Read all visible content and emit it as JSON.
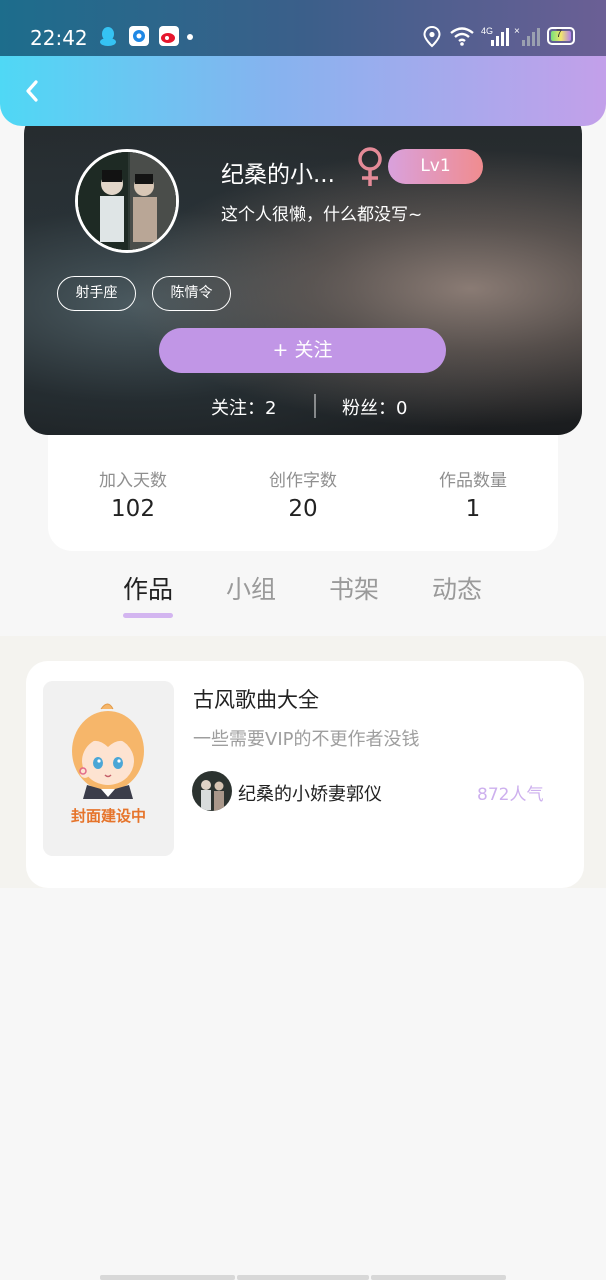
{
  "status_bar": {
    "time": "22:42",
    "battery": "7"
  },
  "header": {
    "back_icon": "chevron-left-icon"
  },
  "profile": {
    "username": "纪桑的小...",
    "gender_icon": "female-icon",
    "level": "Lv1",
    "bio": "这个人很懒，什么都没写~",
    "tags": [
      "射手座",
      "陈情令"
    ],
    "follow_button": "+  关注",
    "following_label": "关注：2",
    "fans_label": "粉丝：0"
  },
  "stats": [
    {
      "label": "加入天数",
      "value": "102"
    },
    {
      "label": "创作字数",
      "value": "20"
    },
    {
      "label": "作品数量",
      "value": "1"
    }
  ],
  "tabs": [
    {
      "label": "作品",
      "active": true
    },
    {
      "label": "小组",
      "active": false
    },
    {
      "label": "书架",
      "active": false
    },
    {
      "label": "动态",
      "active": false
    }
  ],
  "works": [
    {
      "cover_text": "封面建设中",
      "title": "古风歌曲大全",
      "description": "一些需要VIP的不更作者没钱",
      "author": "纪桑的小娇妻郭仪",
      "popularity": "872人气"
    }
  ],
  "colors": {
    "accent": "#c196e6",
    "level_gradient_start": "#d9a1dd",
    "level_gradient_end": "#f08c8f",
    "gender": "#e58b98",
    "popularity": "#cdb0ee"
  }
}
